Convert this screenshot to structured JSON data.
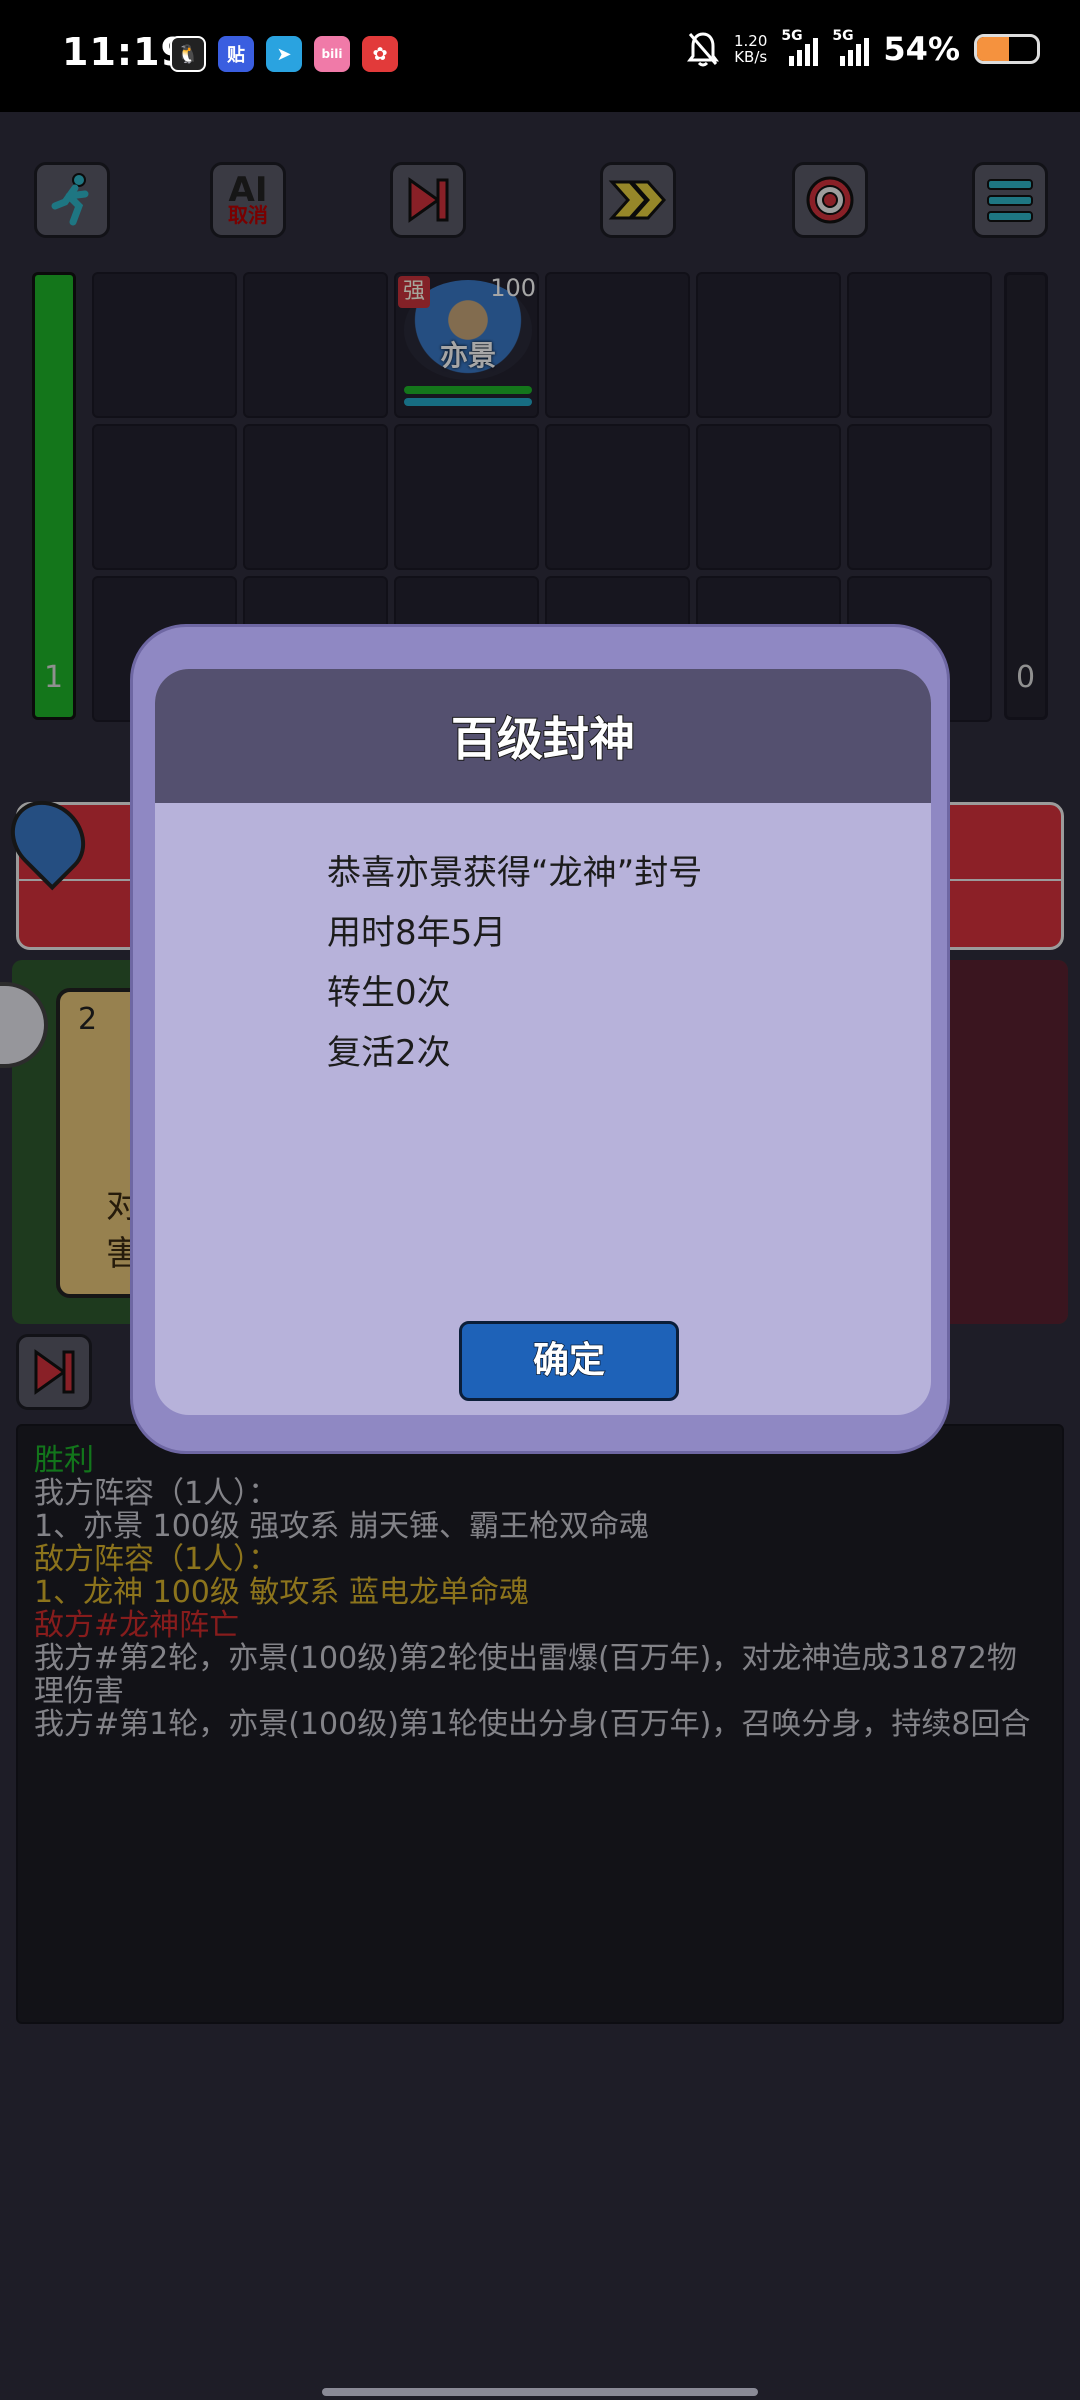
{
  "status_bar": {
    "time": "11:19",
    "net_speed_top": "1.20",
    "net_speed_unit": "KB/s",
    "signal_label_1": "5G",
    "signal_label_2": "5G",
    "battery_pct": "54%",
    "battery_level": 0.54,
    "app_icons": [
      "qq-icon",
      "tieba-icon",
      "telegram-icon",
      "bilibili-icon",
      "lucky-app-icon"
    ]
  },
  "toolbar": {
    "ai_label": "AI",
    "ai_sub": "取消",
    "icons": [
      "runner-icon",
      "ai-cancel-icon",
      "skip-icon",
      "fast-forward-icon",
      "target-icon",
      "menu-icon"
    ]
  },
  "board": {
    "left_count": "1",
    "right_count": "0",
    "hero": {
      "name": "亦景",
      "level": "100",
      "tag": "强"
    }
  },
  "card": {
    "number": "2",
    "text_partial_1": "对",
    "text_partial_2": "害"
  },
  "log": {
    "lines": [
      {
        "text": "胜利",
        "color": "green"
      },
      {
        "text": "我方阵容（1人）：",
        "color": "gray"
      },
      {
        "text": "1、亦景 100级 强攻系 崩天锤、霸王枪双命魂",
        "color": "gray"
      },
      {
        "text": "敌方阵容（1人）：",
        "color": "yellow"
      },
      {
        "text": "1、龙神 100级 敏攻系 蓝电龙单命魂",
        "color": "yellow"
      },
      {
        "text": "敌方#龙神阵亡",
        "color": "red"
      },
      {
        "text": "我方#第2轮，亦景(100级)第2轮使出雷爆(百万年)，对龙神造成31872物理伤害",
        "color": "gray"
      },
      {
        "text": "我方#第1轮，亦景(100级)第1轮使出分身(百万年)，召唤分身，持续8回合",
        "color": "gray"
      }
    ]
  },
  "dialog": {
    "title": "百级封神",
    "lines": [
      "恭喜亦景获得“龙神”封号",
      "用时8年5月",
      "转生0次",
      "复活2次"
    ],
    "confirm_label": "确定"
  }
}
